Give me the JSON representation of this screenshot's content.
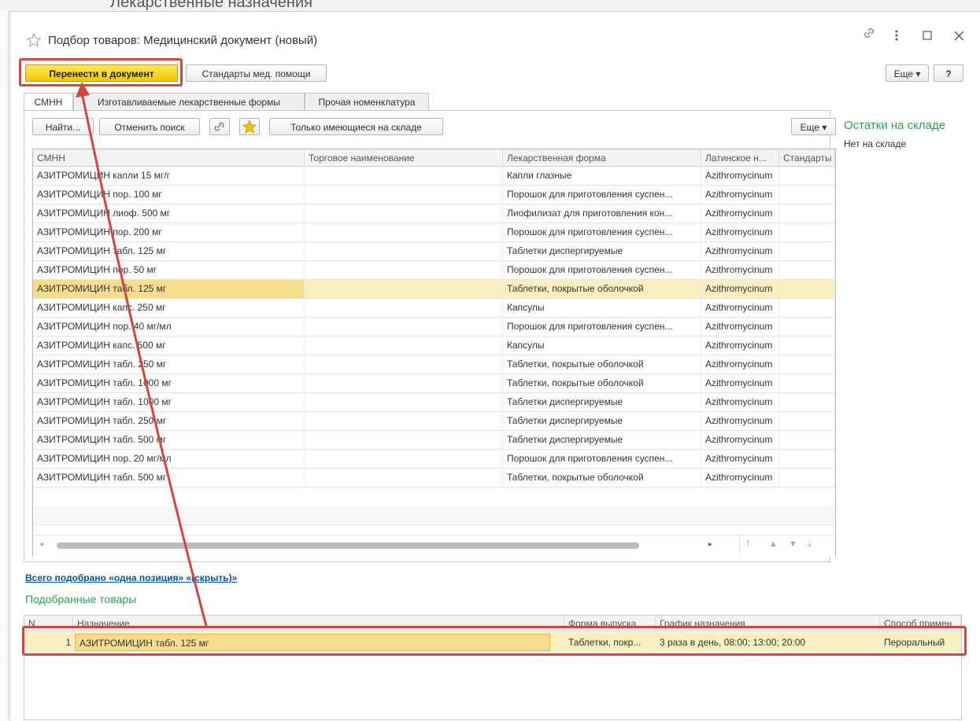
{
  "background_window": {
    "title": "Лекарственные назначения"
  },
  "dialog": {
    "title": "Подбор товаров: Медицинский документ (новый)",
    "icons": {
      "favorite": "star-outline-icon",
      "link": "link-icon",
      "menu": "more-vertical-icon",
      "maximize": "maximize-icon",
      "close": "close-icon"
    }
  },
  "toolbar": {
    "transfer_label": "Перенести в документ",
    "standards_label": "Стандарты мед. помощи",
    "more_label": "Еще ▾",
    "help_label": "?"
  },
  "tabs": [
    {
      "label": "СМНН"
    },
    {
      "label": "Изготавливаемые лекарственные формы"
    },
    {
      "label": "Прочая номенклатура"
    }
  ],
  "table_toolbar": {
    "find_label": "Найти...",
    "cancel_search_label": "Отменить поиск",
    "only_in_stock_label": "Только имеющиеся на складе",
    "more_label": "Еще ▾"
  },
  "table": {
    "columns": [
      "СМНН",
      "Торговое наименование",
      "Лекарственная форма",
      "Латинское н...",
      "Стандарты"
    ],
    "rows": [
      [
        "АЗИТРОМИЦИН капли 15 мг/г",
        "",
        "Капли глазные",
        "Azithromycinum",
        ""
      ],
      [
        "АЗИТРОМИЦИН пор. 100 мг",
        "",
        "Порошок для приготовления суспен...",
        "Azithromycinum",
        ""
      ],
      [
        "АЗИТРОМИЦИН лиоф. 500 мг",
        "",
        "Лиофилизат для приготовления кон...",
        "Azithromycinum",
        ""
      ],
      [
        "АЗИТРОМИЦИН пор. 200 мг",
        "",
        "Порошок для приготовления суспен...",
        "Azithromycinum",
        ""
      ],
      [
        "АЗИТРОМИЦИН табл. 125 мг",
        "",
        "Таблетки диспергируемые",
        "Azithromycinum",
        ""
      ],
      [
        "АЗИТРОМИЦИН пор. 50 мг",
        "",
        "Порошок для приготовления суспен...",
        "Azithromycinum",
        ""
      ],
      [
        "АЗИТРОМИЦИН табл. 125 мг",
        "",
        "Таблетки, покрытые оболочкой",
        "Azithromycinum",
        ""
      ],
      [
        "АЗИТРОМИЦИН капс. 250 мг",
        "",
        "Капсулы",
        "Azithromycinum",
        ""
      ],
      [
        "АЗИТРОМИЦИН пор. 40 мг/мл",
        "",
        "Порошок для приготовления суспен...",
        "Azithromycinum",
        ""
      ],
      [
        "АЗИТРОМИЦИН капс. 500 мг",
        "",
        "Капсулы",
        "Azithromycinum",
        ""
      ],
      [
        "АЗИТРОМИЦИН табл. 250 мг",
        "",
        "Таблетки, покрытые оболочкой",
        "Azithromycinum",
        ""
      ],
      [
        "АЗИТРОМИЦИН табл. 1000 мг",
        "",
        "Таблетки, покрытые оболочкой",
        "Azithromycinum",
        ""
      ],
      [
        "АЗИТРОМИЦИН табл. 1000 мг",
        "",
        "Таблетки диспергируемые",
        "Azithromycinum",
        ""
      ],
      [
        "АЗИТРОМИЦИН табл. 250 мг",
        "",
        "Таблетки диспергируемые",
        "Azithromycinum",
        ""
      ],
      [
        "АЗИТРОМИЦИН табл. 500 мг",
        "",
        "Таблетки диспергируемые",
        "Azithromycinum",
        ""
      ],
      [
        "АЗИТРОМИЦИН пор. 20 мг/мл",
        "",
        "Порошок для приготовления суспен...",
        "Azithromycinum",
        ""
      ],
      [
        "АЗИТРОМИЦИН табл. 500 мг",
        "",
        "Таблетки, покрытые оболочкой",
        "Azithromycinum",
        ""
      ]
    ],
    "selected_row": 6
  },
  "stock_panel": {
    "title": "Остатки на складе",
    "status": "Нет на складе"
  },
  "summary_link": "Всего подобрано «одна позиция» «(скрыть)»",
  "selected_goods": {
    "title": "Подобранные товары",
    "columns": [
      "N",
      "Назначение",
      "Форма выпуска",
      "График назначения",
      "Способ примен"
    ],
    "rows": [
      [
        "1",
        "АЗИТРОМИЦИН табл. 125 мг",
        "Таблетки, покр...",
        "3 раза в день, 08:00; 13:00; 20:00",
        "Пероральный"
      ]
    ]
  },
  "colors": {
    "accent_green": "#2aa055",
    "highlight_red": "#d0473f",
    "selection": "#fbeec0",
    "primary_yellow": "#f2c800"
  }
}
